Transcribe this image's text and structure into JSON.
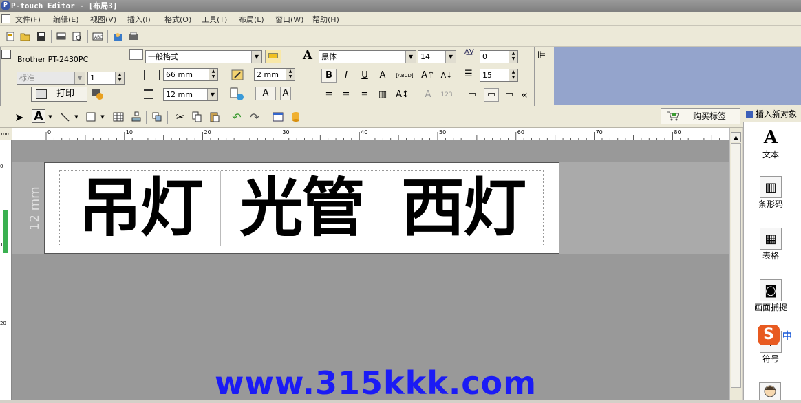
{
  "window": {
    "title": "P-touch Editor - [布局3]",
    "logo": "P"
  },
  "menu": [
    "文件(F)",
    "编辑(E)",
    "视图(V)",
    "插入(I)",
    "格式(O)",
    "工具(T)",
    "布局(L)",
    "窗口(W)",
    "帮助(H)"
  ],
  "toolbar1": {
    "icons": [
      "new-icon",
      "open-icon",
      "save-icon",
      "print-icon",
      "print-preview-icon",
      "spellcheck-icon",
      "address-book-icon",
      "printer-settings-icon"
    ]
  },
  "printer_panel": {
    "printer": "Brother PT-2430PC",
    "mode": "标准",
    "copies": "1",
    "print_label": "打印"
  },
  "paper_panel": {
    "format": "一般格式",
    "length": "66 mm",
    "margin": "2 mm",
    "tape": "12 mm",
    "text_box_glyph": "A"
  },
  "font_panel": {
    "font": "黑体",
    "size": "14",
    "spacing": "0",
    "line_spacing": "15",
    "bold": "B",
    "italic": "I",
    "underline": "U",
    "collapse": "«"
  },
  "toolbar2": {
    "buy_label": "购买标签"
  },
  "ruler": {
    "unit": "mm",
    "ticks": [
      "0",
      "10",
      "20",
      "30",
      "40",
      "50",
      "60",
      "70",
      "80"
    ],
    "side_ticks": [
      "0",
      "10",
      "20"
    ]
  },
  "label": {
    "height_label": "12 mm",
    "cells": [
      "吊灯",
      "光管",
      "西灯"
    ]
  },
  "watermark": "www.315kkk.com",
  "sidebar": {
    "title": "插入新对象",
    "items": [
      {
        "label": "文本",
        "icon": "text-icon",
        "glyph": "A"
      },
      {
        "label": "条形码",
        "icon": "barcode-icon",
        "glyph": "▥"
      },
      {
        "label": "表格",
        "icon": "table-icon",
        "glyph": "▦"
      },
      {
        "label": "画面捕捉",
        "icon": "screen-capture-icon",
        "glyph": "◙"
      },
      {
        "label": "符号",
        "icon": "symbol-icon",
        "glyph": "※"
      }
    ],
    "ime": {
      "logo": "S",
      "text": "中"
    }
  }
}
